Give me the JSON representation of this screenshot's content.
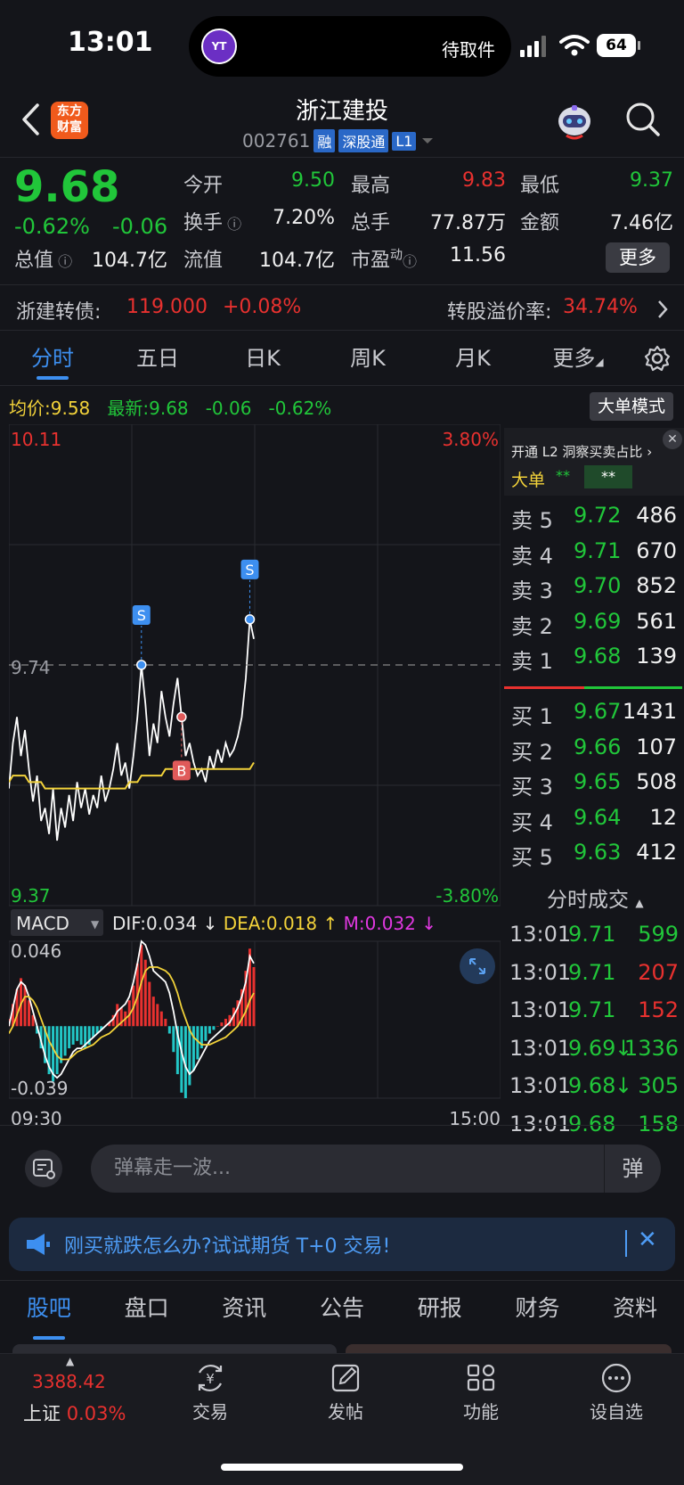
{
  "status_bar": {
    "time": "13:01",
    "island_text": "待取件",
    "island_badge": "YT",
    "battery": "64"
  },
  "header": {
    "logo": "东方\n财富",
    "logo_line1": "东方",
    "logo_line2": "财富",
    "name": "浙江建投",
    "code": "002761",
    "tags": [
      "融",
      "深股通",
      "L1"
    ]
  },
  "quote": {
    "price": "9.68",
    "change_pct": "-0.62%",
    "change": "-0.06",
    "open_label": "今开",
    "open": "9.50",
    "high_label": "最高",
    "high": "9.83",
    "low_label": "最低",
    "low": "9.37",
    "turnover_label": "换手",
    "turnover": "7.20%",
    "volume_label": "总手",
    "volume": "77.87万",
    "amount_label": "金额",
    "amount": "7.46亿",
    "mktcap_label": "总值",
    "mktcap": "104.7亿",
    "float_label": "流值",
    "float": "104.7亿",
    "pe_label": "市盈",
    "pe_sup": "动",
    "pe": "11.56",
    "more": "更多"
  },
  "convertible": {
    "label": "浙建转债:",
    "price": "119.000",
    "chg": "+0.08%",
    "premium_label": "转股溢价率:",
    "premium": "34.74%"
  },
  "tabs": [
    "分时",
    "五日",
    "日K",
    "周K",
    "月K",
    "更多"
  ],
  "avg_row": {
    "avg_label": "均价:",
    "avg": "9.58",
    "last_label": "最新:",
    "last": "9.68",
    "chg": "-0.06",
    "pct": "-0.62%",
    "big_mode": "大单模式"
  },
  "chart_data": {
    "type": "line",
    "y_top": "10.11",
    "y_mid": "9.74",
    "y_bottom": "9.37",
    "pct_top": "3.80%",
    "pct_bottom": "-3.80%",
    "x_start": "09:30",
    "x_end": "15:00",
    "ylim": [
      9.37,
      10.11
    ],
    "price": [
      9.55,
      9.62,
      9.66,
      9.6,
      9.64,
      9.58,
      9.53,
      9.57,
      9.5,
      9.52,
      9.48,
      9.55,
      9.47,
      9.52,
      9.49,
      9.54,
      9.5,
      9.56,
      9.52,
      9.55,
      9.51,
      9.54,
      9.52,
      9.57,
      9.53,
      9.55,
      9.58,
      9.62,
      9.57,
      9.59,
      9.55,
      9.6,
      9.66,
      9.74,
      9.68,
      9.6,
      9.65,
      9.62,
      9.7,
      9.66,
      9.63,
      9.68,
      9.72,
      9.66,
      9.6,
      9.62,
      9.59,
      9.57,
      9.58,
      9.56,
      9.6,
      9.58,
      9.61,
      9.59,
      9.62,
      9.6,
      9.61,
      9.63,
      9.66,
      9.72,
      9.81,
      9.78
    ],
    "avg": [
      9.56,
      9.57,
      9.57,
      9.57,
      9.57,
      9.56,
      9.56,
      9.56,
      9.56,
      9.55,
      9.55,
      9.55,
      9.55,
      9.55,
      9.55,
      9.55,
      9.55,
      9.55,
      9.55,
      9.55,
      9.55,
      9.55,
      9.55,
      9.55,
      9.55,
      9.55,
      9.55,
      9.55,
      9.55,
      9.55,
      9.56,
      9.56,
      9.56,
      9.57,
      9.57,
      9.57,
      9.57,
      9.57,
      9.57,
      9.58,
      9.58,
      9.58,
      9.58,
      9.58,
      9.58,
      9.58,
      9.58,
      9.58,
      9.58,
      9.58,
      9.58,
      9.58,
      9.58,
      9.58,
      9.58,
      9.58,
      9.58,
      9.58,
      9.58,
      9.58,
      9.58,
      9.59
    ],
    "markers": [
      {
        "label": "S",
        "index": 33
      },
      {
        "label": "S",
        "index": 60
      },
      {
        "label": "B",
        "index": 43
      }
    ],
    "macd": {
      "label": "MACD",
      "dif_label": "DIF:",
      "dif": "0.034",
      "dea_label": "DEA:",
      "dea": "0.018",
      "m_label": "M:",
      "m": "0.032",
      "top": "0.046",
      "bottom": "-0.039",
      "ylim": [
        -0.039,
        0.046
      ],
      "hist": [
        0.004,
        0.012,
        0.02,
        0.026,
        0.022,
        0.014,
        0.006,
        -0.004,
        -0.012,
        -0.02,
        -0.026,
        -0.03,
        -0.026,
        -0.02,
        -0.016,
        -0.012,
        -0.01,
        -0.008,
        -0.01,
        -0.012,
        -0.01,
        -0.006,
        -0.004,
        -0.002,
        0.0,
        0.002,
        0.006,
        0.012,
        0.01,
        0.008,
        0.014,
        0.022,
        0.034,
        0.044,
        0.036,
        0.024,
        0.016,
        0.012,
        0.008,
        0.004,
        -0.004,
        -0.014,
        -0.026,
        -0.036,
        -0.039,
        -0.032,
        -0.024,
        -0.018,
        -0.012,
        -0.008,
        -0.004,
        -0.002,
        0.0,
        0.002,
        0.004,
        0.006,
        0.01,
        0.014,
        0.02,
        0.03,
        0.042,
        0.032
      ],
      "dif_line": [
        0.0,
        0.01,
        0.02,
        0.024,
        0.022,
        0.016,
        0.008,
        0.0,
        -0.008,
        -0.016,
        -0.022,
        -0.026,
        -0.028,
        -0.026,
        -0.022,
        -0.018,
        -0.014,
        -0.012,
        -0.012,
        -0.01,
        -0.008,
        -0.006,
        -0.004,
        -0.002,
        0.0,
        0.002,
        0.004,
        0.008,
        0.01,
        0.012,
        0.016,
        0.024,
        0.034,
        0.046,
        0.044,
        0.038,
        0.03,
        0.028,
        0.026,
        0.024,
        0.018,
        0.008,
        -0.004,
        -0.014,
        -0.022,
        -0.026,
        -0.024,
        -0.02,
        -0.016,
        -0.012,
        -0.008,
        -0.006,
        -0.004,
        -0.002,
        0.0,
        0.002,
        0.006,
        0.01,
        0.016,
        0.024,
        0.038,
        0.034
      ],
      "dea_line": [
        -0.004,
        0.0,
        0.006,
        0.012,
        0.016,
        0.016,
        0.014,
        0.01,
        0.004,
        -0.002,
        -0.008,
        -0.012,
        -0.016,
        -0.018,
        -0.018,
        -0.018,
        -0.016,
        -0.014,
        -0.013,
        -0.012,
        -0.011,
        -0.01,
        -0.008,
        -0.006,
        -0.005,
        -0.004,
        -0.002,
        0.0,
        0.002,
        0.004,
        0.006,
        0.01,
        0.016,
        0.024,
        0.03,
        0.032,
        0.032,
        0.032,
        0.031,
        0.03,
        0.028,
        0.024,
        0.018,
        0.01,
        0.004,
        -0.002,
        -0.006,
        -0.008,
        -0.01,
        -0.01,
        -0.01,
        -0.009,
        -0.008,
        -0.007,
        -0.006,
        -0.004,
        -0.002,
        0.0,
        0.004,
        0.008,
        0.014,
        0.018
      ]
    }
  },
  "l2": {
    "title": "开通 L2 洞察买卖占比",
    "big_label": "大单",
    "big_a": "**",
    "big_b": "**"
  },
  "order_book": {
    "asks": [
      {
        "label": "卖 5",
        "price": "9.72",
        "vol": "486"
      },
      {
        "label": "卖 4",
        "price": "9.71",
        "vol": "670"
      },
      {
        "label": "卖 3",
        "price": "9.70",
        "vol": "852"
      },
      {
        "label": "卖 2",
        "price": "9.69",
        "vol": "561"
      },
      {
        "label": "卖 1",
        "price": "9.68",
        "vol": "139"
      }
    ],
    "bids": [
      {
        "label": "买 1",
        "price": "9.67",
        "vol": "1431"
      },
      {
        "label": "买 2",
        "price": "9.66",
        "vol": "107"
      },
      {
        "label": "买 3",
        "price": "9.65",
        "vol": "508"
      },
      {
        "label": "买 4",
        "price": "9.64",
        "vol": "12"
      },
      {
        "label": "买 5",
        "price": "9.63",
        "vol": "412"
      }
    ]
  },
  "trades": {
    "title": "分时成交",
    "rows": [
      {
        "time": "13:01",
        "price": "9.71",
        "arrow": "",
        "vol": "599",
        "color": "green"
      },
      {
        "time": "13:01",
        "price": "9.71",
        "arrow": "",
        "vol": "207",
        "color": "red"
      },
      {
        "time": "13:01",
        "price": "9.71",
        "arrow": "",
        "vol": "152",
        "color": "red"
      },
      {
        "time": "13:01",
        "price": "9.69",
        "arrow": "↓",
        "vol": "1336",
        "color": "green"
      },
      {
        "time": "13:01",
        "price": "9.68",
        "arrow": "↓",
        "vol": "305",
        "color": "green"
      },
      {
        "time": "13:01",
        "price": "9.68",
        "arrow": "",
        "vol": "158",
        "color": "green"
      }
    ]
  },
  "barrage": {
    "placeholder": "弹幕走一波...",
    "send": "弹"
  },
  "promo": {
    "text": "刚买就跌怎么办?试试期货 T+0 交易!",
    "close": "✕"
  },
  "sub_tabs": [
    "股吧",
    "盘口",
    "资讯",
    "公告",
    "研报",
    "财务",
    "资料"
  ],
  "bottom_nav": {
    "index_value": "3388.42",
    "index_name": "上证",
    "index_pct": "0.03%",
    "items": [
      "交易",
      "发帖",
      "功能",
      "设自选"
    ]
  },
  "colors": {
    "up": "#e8312f",
    "down": "#21c63a",
    "accent": "#3d8ff0",
    "avg_line": "#f2d23a"
  }
}
